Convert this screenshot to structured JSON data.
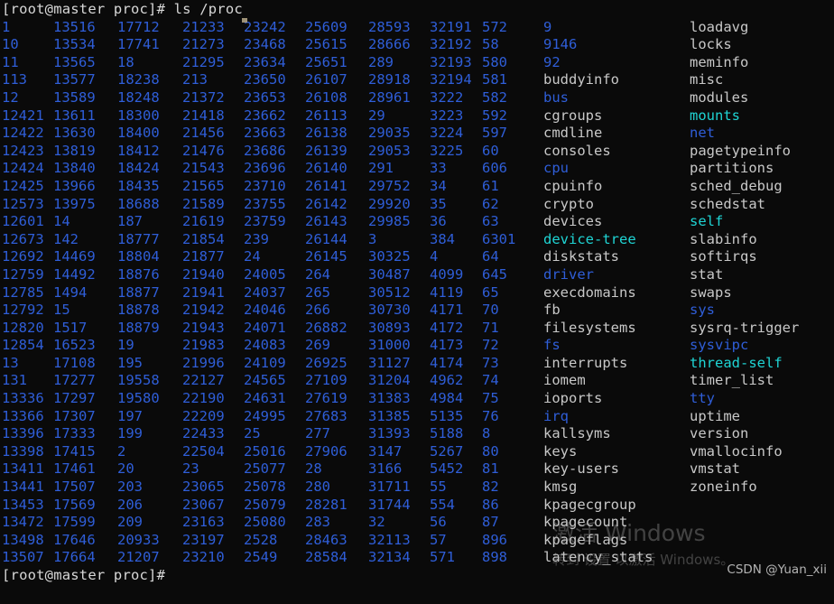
{
  "terminal": {
    "prompt_top": "[root@master proc]# ls /proc",
    "prompt_bottom": "[root@master proc]#",
    "colors": {
      "background": "#0a0a0a",
      "directory": "#2f5ed8",
      "file": "#c8c8c8",
      "symlink": "#1fd4d4",
      "prompt": "#d8d8d8"
    }
  },
  "watermark": {
    "title": "激活 Windows",
    "subtitle": "转到 设置 以激活 Windows。",
    "credit": "CSDN @Yuan_xii"
  },
  "listing": {
    "columns": [
      {
        "index": 0,
        "type": "dir",
        "entries": [
          "1",
          "10",
          "11",
          "113",
          "12",
          "12421",
          "12422",
          "12423",
          "12424",
          "12425",
          "12573",
          "12601",
          "12673",
          "12692",
          "12759",
          "12785",
          "12792",
          "12820",
          "12854",
          "13",
          "131",
          "13336",
          "13366",
          "13396",
          "13398",
          "13411",
          "13441",
          "13453",
          "13472",
          "13498",
          "13507"
        ]
      },
      {
        "index": 1,
        "type": "dir",
        "entries": [
          "13516",
          "13534",
          "13565",
          "13577",
          "13589",
          "13611",
          "13630",
          "13819",
          "13840",
          "13966",
          "13975",
          "14",
          "142",
          "14469",
          "14492",
          "1494",
          "15",
          "1517",
          "16523",
          "17108",
          "17277",
          "17297",
          "17307",
          "17333",
          "17415",
          "17461",
          "17507",
          "17569",
          "17599",
          "17646",
          "17664"
        ]
      },
      {
        "index": 2,
        "type": "dir",
        "entries": [
          "17712",
          "17741",
          "18",
          "18238",
          "18248",
          "18300",
          "18400",
          "18412",
          "18424",
          "18435",
          "18688",
          "187",
          "18777",
          "18804",
          "18876",
          "18877",
          "18878",
          "18879",
          "19",
          "195",
          "19558",
          "19580",
          "197",
          "199",
          "2",
          "20",
          "203",
          "206",
          "209",
          "20933",
          "21207"
        ]
      },
      {
        "index": 3,
        "type": "dir",
        "entries": [
          "21233",
          "21273",
          "21295",
          "213",
          "21372",
          "21418",
          "21456",
          "21476",
          "21543",
          "21565",
          "21589",
          "21619",
          "21854",
          "21877",
          "21940",
          "21941",
          "21942",
          "21943",
          "21983",
          "21996",
          "22127",
          "22190",
          "22209",
          "22433",
          "22504",
          "23",
          "23065",
          "23067",
          "23163",
          "23197",
          "23210"
        ]
      },
      {
        "index": 4,
        "type": "dir",
        "entries": [
          "23242",
          "23468",
          "23634",
          "23650",
          "23653",
          "23662",
          "23663",
          "23686",
          "23696",
          "23710",
          "23755",
          "23759",
          "239",
          "24",
          "24005",
          "24037",
          "24046",
          "24071",
          "24083",
          "24109",
          "24565",
          "24631",
          "24995",
          "25",
          "25016",
          "25077",
          "25078",
          "25079",
          "25080",
          "2528",
          "2549"
        ]
      },
      {
        "index": 5,
        "type": "dir",
        "entries": [
          "25609",
          "25615",
          "25651",
          "26107",
          "26108",
          "26113",
          "26138",
          "26139",
          "26140",
          "26141",
          "26142",
          "26143",
          "26144",
          "26145",
          "264",
          "265",
          "266",
          "26882",
          "269",
          "26925",
          "27109",
          "27619",
          "27683",
          "277",
          "27906",
          "28",
          "280",
          "28281",
          "283",
          "28463",
          "28584"
        ]
      },
      {
        "index": 6,
        "type": "dir",
        "entries": [
          "28593",
          "28666",
          "289",
          "28918",
          "28961",
          "29",
          "29035",
          "29053",
          "291",
          "29752",
          "29920",
          "29985",
          "3",
          "30325",
          "30487",
          "30512",
          "30730",
          "30893",
          "31000",
          "31127",
          "31204",
          "31383",
          "31385",
          "31393",
          "3147",
          "3166",
          "31711",
          "31744",
          "32",
          "32113",
          "32134"
        ]
      },
      {
        "index": 7,
        "type": "dir",
        "entries": [
          "32191",
          "32192",
          "32193",
          "32194",
          "3222",
          "3223",
          "3224",
          "3225",
          "33",
          "34",
          "35",
          "36",
          "384",
          "4",
          "4099",
          "4119",
          "4171",
          "4172",
          "4173",
          "4174",
          "4962",
          "4984",
          "5135",
          "5188",
          "5267",
          "5452",
          "55",
          "554",
          "56",
          "57",
          "571"
        ]
      },
      {
        "index": 8,
        "type": "dir",
        "entries": [
          "572",
          "58",
          "580",
          "581",
          "582",
          "592",
          "597",
          "60",
          "606",
          "61",
          "62",
          "63",
          "6301",
          "64",
          "645",
          "65",
          "70",
          "71",
          "72",
          "73",
          "74",
          "75",
          "76",
          "8",
          "80",
          "81",
          "82",
          "86",
          "87",
          "896",
          "898"
        ]
      },
      {
        "index": 9,
        "entries": [
          {
            "name": "9",
            "type": "dir"
          },
          {
            "name": "9146",
            "type": "dir"
          },
          {
            "name": "92",
            "type": "dir"
          },
          {
            "name": "buddyinfo",
            "type": "file"
          },
          {
            "name": "bus",
            "type": "dir"
          },
          {
            "name": "cgroups",
            "type": "file"
          },
          {
            "name": "cmdline",
            "type": "file"
          },
          {
            "name": "consoles",
            "type": "file"
          },
          {
            "name": "cpu",
            "type": "dir"
          },
          {
            "name": "cpuinfo",
            "type": "file"
          },
          {
            "name": "crypto",
            "type": "file"
          },
          {
            "name": "devices",
            "type": "file"
          },
          {
            "name": "device-tree",
            "type": "link"
          },
          {
            "name": "diskstats",
            "type": "file"
          },
          {
            "name": "driver",
            "type": "dir"
          },
          {
            "name": "execdomains",
            "type": "file"
          },
          {
            "name": "fb",
            "type": "file"
          },
          {
            "name": "filesystems",
            "type": "file"
          },
          {
            "name": "fs",
            "type": "dir"
          },
          {
            "name": "interrupts",
            "type": "file"
          },
          {
            "name": "iomem",
            "type": "file"
          },
          {
            "name": "ioports",
            "type": "file"
          },
          {
            "name": "irq",
            "type": "dir"
          },
          {
            "name": "kallsyms",
            "type": "file"
          },
          {
            "name": "keys",
            "type": "file"
          },
          {
            "name": "key-users",
            "type": "file"
          },
          {
            "name": "kmsg",
            "type": "file"
          },
          {
            "name": "kpagecgroup",
            "type": "file"
          },
          {
            "name": "kpagecount",
            "type": "file"
          },
          {
            "name": "kpageflags",
            "type": "file"
          },
          {
            "name": "latency_stats",
            "type": "file"
          }
        ]
      },
      {
        "index": 10,
        "entries": [
          {
            "name": "loadavg",
            "type": "file"
          },
          {
            "name": "locks",
            "type": "file"
          },
          {
            "name": "meminfo",
            "type": "file"
          },
          {
            "name": "misc",
            "type": "file"
          },
          {
            "name": "modules",
            "type": "file"
          },
          {
            "name": "mounts",
            "type": "link"
          },
          {
            "name": "net",
            "type": "dir"
          },
          {
            "name": "pagetypeinfo",
            "type": "file"
          },
          {
            "name": "partitions",
            "type": "file"
          },
          {
            "name": "sched_debug",
            "type": "file"
          },
          {
            "name": "schedstat",
            "type": "file"
          },
          {
            "name": "self",
            "type": "link"
          },
          {
            "name": "slabinfo",
            "type": "file"
          },
          {
            "name": "softirqs",
            "type": "file"
          },
          {
            "name": "stat",
            "type": "file"
          },
          {
            "name": "swaps",
            "type": "file"
          },
          {
            "name": "sys",
            "type": "dir"
          },
          {
            "name": "sysrq-trigger",
            "type": "file"
          },
          {
            "name": "sysvipc",
            "type": "dir"
          },
          {
            "name": "thread-self",
            "type": "link"
          },
          {
            "name": "timer_list",
            "type": "file"
          },
          {
            "name": "tty",
            "type": "dir"
          },
          {
            "name": "uptime",
            "type": "file"
          },
          {
            "name": "version",
            "type": "file"
          },
          {
            "name": "vmallocinfo",
            "type": "file"
          },
          {
            "name": "vmstat",
            "type": "file"
          },
          {
            "name": "zoneinfo",
            "type": "file"
          }
        ]
      }
    ]
  }
}
